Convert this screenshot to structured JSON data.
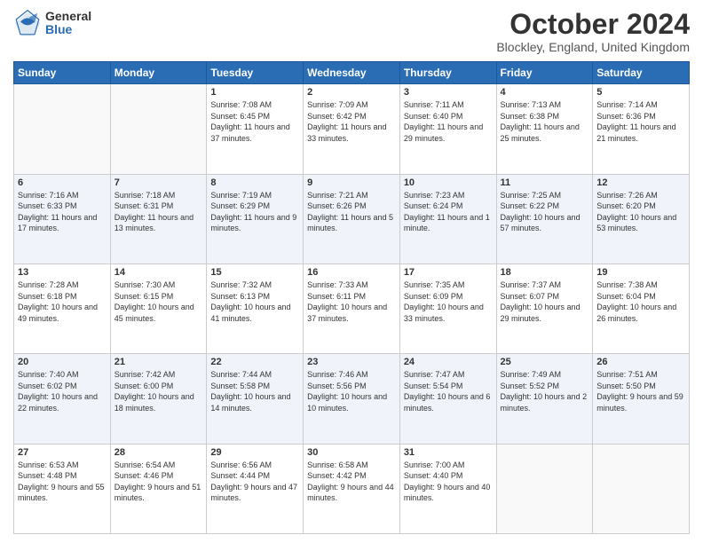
{
  "logo": {
    "general": "General",
    "blue": "Blue"
  },
  "title": "October 2024",
  "location": "Blockley, England, United Kingdom",
  "days_of_week": [
    "Sunday",
    "Monday",
    "Tuesday",
    "Wednesday",
    "Thursday",
    "Friday",
    "Saturday"
  ],
  "weeks": [
    [
      {
        "day": "",
        "info": ""
      },
      {
        "day": "",
        "info": ""
      },
      {
        "day": "1",
        "info": "Sunrise: 7:08 AM\nSunset: 6:45 PM\nDaylight: 11 hours and 37 minutes."
      },
      {
        "day": "2",
        "info": "Sunrise: 7:09 AM\nSunset: 6:42 PM\nDaylight: 11 hours and 33 minutes."
      },
      {
        "day": "3",
        "info": "Sunrise: 7:11 AM\nSunset: 6:40 PM\nDaylight: 11 hours and 29 minutes."
      },
      {
        "day": "4",
        "info": "Sunrise: 7:13 AM\nSunset: 6:38 PM\nDaylight: 11 hours and 25 minutes."
      },
      {
        "day": "5",
        "info": "Sunrise: 7:14 AM\nSunset: 6:36 PM\nDaylight: 11 hours and 21 minutes."
      }
    ],
    [
      {
        "day": "6",
        "info": "Sunrise: 7:16 AM\nSunset: 6:33 PM\nDaylight: 11 hours and 17 minutes."
      },
      {
        "day": "7",
        "info": "Sunrise: 7:18 AM\nSunset: 6:31 PM\nDaylight: 11 hours and 13 minutes."
      },
      {
        "day": "8",
        "info": "Sunrise: 7:19 AM\nSunset: 6:29 PM\nDaylight: 11 hours and 9 minutes."
      },
      {
        "day": "9",
        "info": "Sunrise: 7:21 AM\nSunset: 6:26 PM\nDaylight: 11 hours and 5 minutes."
      },
      {
        "day": "10",
        "info": "Sunrise: 7:23 AM\nSunset: 6:24 PM\nDaylight: 11 hours and 1 minute."
      },
      {
        "day": "11",
        "info": "Sunrise: 7:25 AM\nSunset: 6:22 PM\nDaylight: 10 hours and 57 minutes."
      },
      {
        "day": "12",
        "info": "Sunrise: 7:26 AM\nSunset: 6:20 PM\nDaylight: 10 hours and 53 minutes."
      }
    ],
    [
      {
        "day": "13",
        "info": "Sunrise: 7:28 AM\nSunset: 6:18 PM\nDaylight: 10 hours and 49 minutes."
      },
      {
        "day": "14",
        "info": "Sunrise: 7:30 AM\nSunset: 6:15 PM\nDaylight: 10 hours and 45 minutes."
      },
      {
        "day": "15",
        "info": "Sunrise: 7:32 AM\nSunset: 6:13 PM\nDaylight: 10 hours and 41 minutes."
      },
      {
        "day": "16",
        "info": "Sunrise: 7:33 AM\nSunset: 6:11 PM\nDaylight: 10 hours and 37 minutes."
      },
      {
        "day": "17",
        "info": "Sunrise: 7:35 AM\nSunset: 6:09 PM\nDaylight: 10 hours and 33 minutes."
      },
      {
        "day": "18",
        "info": "Sunrise: 7:37 AM\nSunset: 6:07 PM\nDaylight: 10 hours and 29 minutes."
      },
      {
        "day": "19",
        "info": "Sunrise: 7:38 AM\nSunset: 6:04 PM\nDaylight: 10 hours and 26 minutes."
      }
    ],
    [
      {
        "day": "20",
        "info": "Sunrise: 7:40 AM\nSunset: 6:02 PM\nDaylight: 10 hours and 22 minutes."
      },
      {
        "day": "21",
        "info": "Sunrise: 7:42 AM\nSunset: 6:00 PM\nDaylight: 10 hours and 18 minutes."
      },
      {
        "day": "22",
        "info": "Sunrise: 7:44 AM\nSunset: 5:58 PM\nDaylight: 10 hours and 14 minutes."
      },
      {
        "day": "23",
        "info": "Sunrise: 7:46 AM\nSunset: 5:56 PM\nDaylight: 10 hours and 10 minutes."
      },
      {
        "day": "24",
        "info": "Sunrise: 7:47 AM\nSunset: 5:54 PM\nDaylight: 10 hours and 6 minutes."
      },
      {
        "day": "25",
        "info": "Sunrise: 7:49 AM\nSunset: 5:52 PM\nDaylight: 10 hours and 2 minutes."
      },
      {
        "day": "26",
        "info": "Sunrise: 7:51 AM\nSunset: 5:50 PM\nDaylight: 9 hours and 59 minutes."
      }
    ],
    [
      {
        "day": "27",
        "info": "Sunrise: 6:53 AM\nSunset: 4:48 PM\nDaylight: 9 hours and 55 minutes."
      },
      {
        "day": "28",
        "info": "Sunrise: 6:54 AM\nSunset: 4:46 PM\nDaylight: 9 hours and 51 minutes."
      },
      {
        "day": "29",
        "info": "Sunrise: 6:56 AM\nSunset: 4:44 PM\nDaylight: 9 hours and 47 minutes."
      },
      {
        "day": "30",
        "info": "Sunrise: 6:58 AM\nSunset: 4:42 PM\nDaylight: 9 hours and 44 minutes."
      },
      {
        "day": "31",
        "info": "Sunrise: 7:00 AM\nSunset: 4:40 PM\nDaylight: 9 hours and 40 minutes."
      },
      {
        "day": "",
        "info": ""
      },
      {
        "day": "",
        "info": ""
      }
    ]
  ]
}
